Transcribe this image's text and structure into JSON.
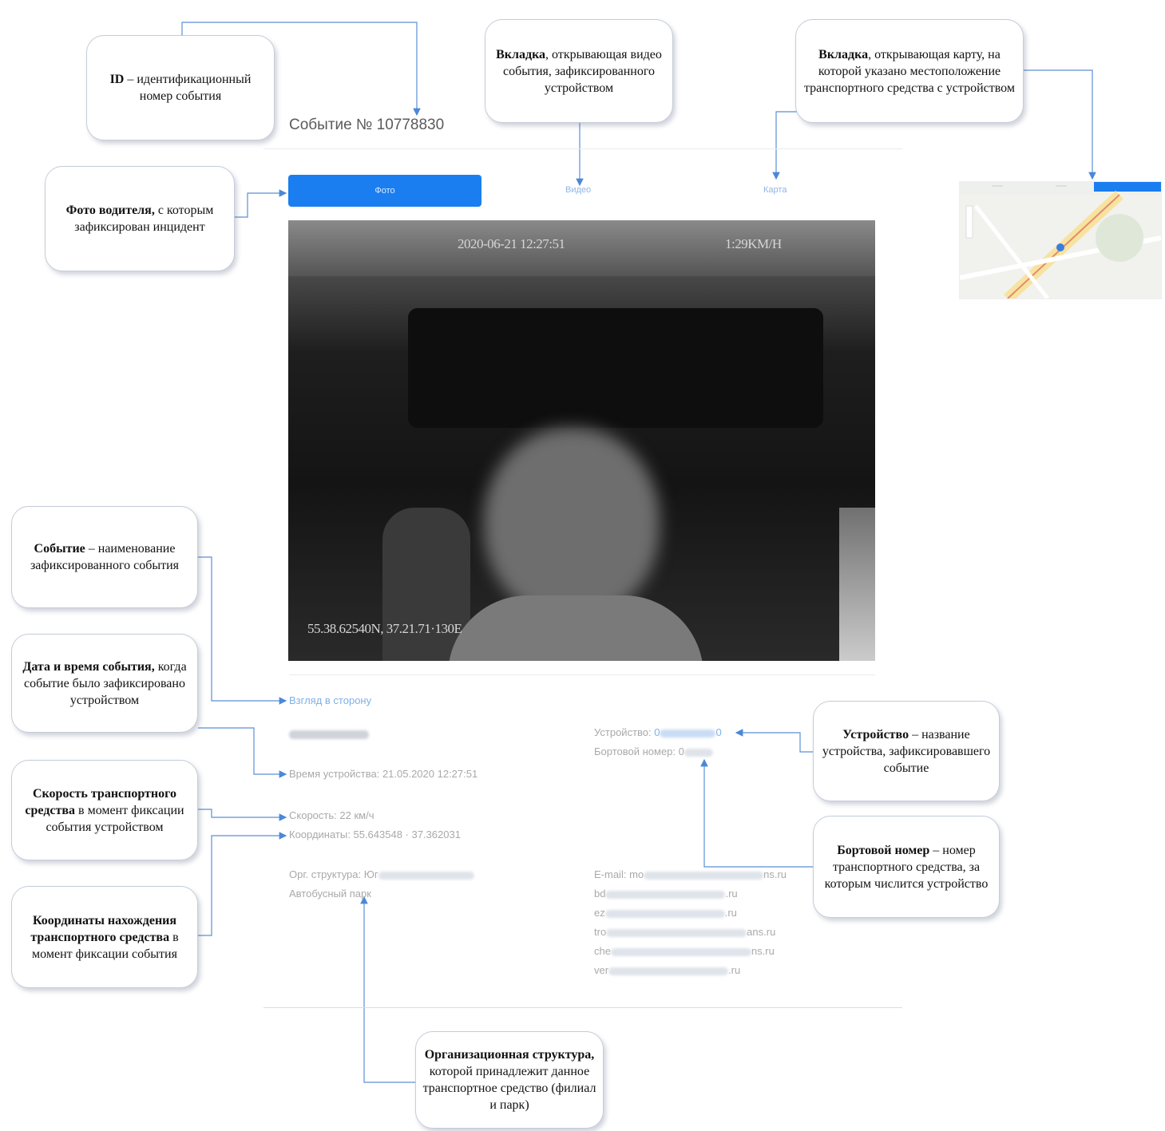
{
  "event": {
    "title": "Событие № 10778830"
  },
  "tabs": {
    "photo": "Фото",
    "video": "Видео",
    "map": "Карта"
  },
  "photo_overlay": {
    "datetime": "2020-06-21 12:27:51",
    "speed": "1:29KM/H",
    "coords": "55.38.62540N, 37.21.71·130E"
  },
  "details": {
    "event_name": "Взгляд в сторону",
    "device_time_label": "Время устройства:",
    "device_time_value": "21.05.2020 12:27:51",
    "speed_label": "Скорость:",
    "speed_value": "22 км/ч",
    "coords_label": "Координаты:",
    "coords_value": "55.643548 · 37.362031",
    "org_label": "Орг. структура:",
    "org_value_start": "Юг",
    "org_value_end": "Автобусный парк",
    "device_label": "Устройство:",
    "device_value_start": "0",
    "device_value_end": "0",
    "board_label": "Бортовой номер:",
    "board_value_start": "0",
    "email_label": "E-mail:",
    "emails": [
      {
        "start": "mo",
        "end": "ns.ru"
      },
      {
        "start": "bd",
        "end": ".ru"
      },
      {
        "start": "ez",
        "end": ".ru"
      },
      {
        "start": "tro",
        "end": "ans.ru"
      },
      {
        "start": "che",
        "end": "ns.ru"
      },
      {
        "start": "ver",
        "end": ".ru"
      }
    ]
  },
  "callouts": {
    "id": {
      "bold": "ID",
      "rest": "– идентификационный номер события"
    },
    "video": {
      "bold": "Вкладка",
      "rest": ", открывающая видео события, зафиксированного устройством"
    },
    "map": {
      "bold": "Вкладка",
      "rest": ", открывающая карту, на которой указано местоположение транспортного средства с устройством"
    },
    "driver_photo": {
      "bold": "Фото водителя,",
      "rest": " с которым зафиксирован инцидент"
    },
    "event_name": {
      "bold": "Событие",
      "rest": " – наименование зафиксированного события"
    },
    "datetime": {
      "bold": "Дата и время события,",
      "rest": " когда событие было зафиксировано устройством"
    },
    "speed": {
      "bold": "Скорость транспортного средства",
      "rest": " в момент фиксации события устройством"
    },
    "coords": {
      "bold": "Координаты нахождения транспортного средства",
      "rest": " в момент фиксации события"
    },
    "device": {
      "bold": "Устройство",
      "rest": " – название устройства, зафиксировавшего событие"
    },
    "board": {
      "bold": "Бортовой номер",
      "rest": " – номер транспортного средства, за которым числится устройство"
    },
    "org": {
      "bold": "Организационная структура,",
      "rest": " которой принадлежит данное транспортное средство (филиал и парк)"
    }
  },
  "colors": {
    "accent": "#1a7ef0",
    "link": "#7fb0ea",
    "callout_border": "#c5ccd8"
  }
}
